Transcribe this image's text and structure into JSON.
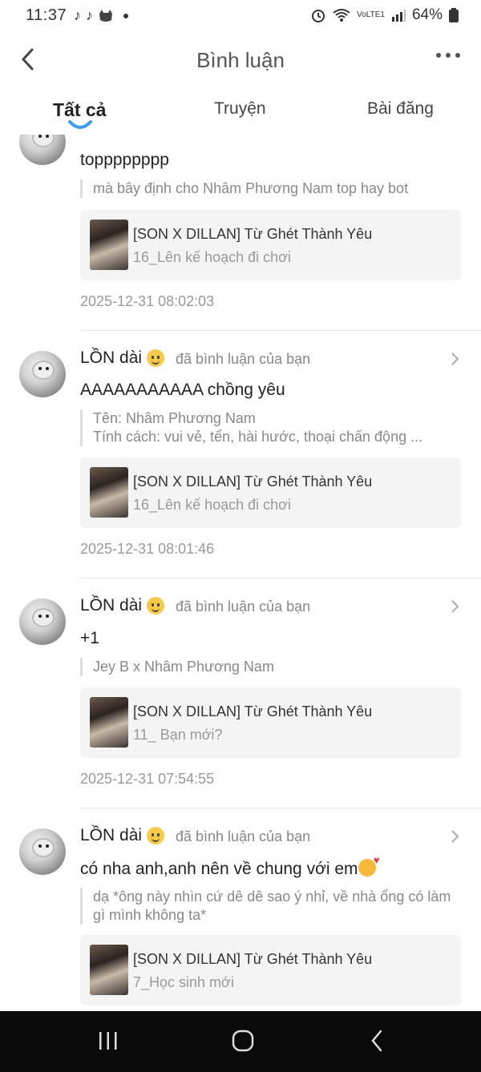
{
  "status_bar": {
    "time": "11:37",
    "battery": "64%",
    "network": "VoLTE1"
  },
  "header": {
    "title": "Bình luận"
  },
  "tabs": [
    {
      "label": "Tất cả",
      "active": true
    },
    {
      "label": "Truyện",
      "active": false
    },
    {
      "label": "Bài đăng",
      "active": false
    }
  ],
  "items": [
    {
      "comment": "topppppppp",
      "quote": "mà bây định cho Nhâm Phương Nam top hay bot",
      "card_title": "[SON X DILLAN] Từ Ghét Thành Yêu",
      "card_sub": "16_Lên kế hoạch đi chơi",
      "timestamp": "2025-12-31 08:02:03"
    },
    {
      "user": "LỒN dài",
      "action": "đã bình luận của bạn",
      "comment": "AAAAAAAAAAA chồng yêu",
      "quote_line1": "Tên: Nhâm Phương Nam",
      "quote_line2": "Tính cách: vui vẻ, tển, hài hước, thoại chấn động ...",
      "card_title": "[SON X DILLAN] Từ Ghét Thành Yêu",
      "card_sub": "16_Lên kế hoạch đi chơi",
      "timestamp": "2025-12-31 08:01:46"
    },
    {
      "user": "LỒN dài",
      "action": "đã bình luận của bạn",
      "comment": "+1",
      "quote": "Jey B x Nhâm Phương Nam",
      "card_title": "[SON X DILLAN] Từ Ghét Thành Yêu",
      "card_sub": "11_ Bạn mới?",
      "timestamp": "2025-12-31 07:54:55"
    },
    {
      "user": "LỒN dài",
      "action": "đã bình luận của bạn",
      "comment": "có nha anh,anh nên về chung với em",
      "quote_line1": "dạ *ông này nhìn cứ dê dê sao ý nhỉ, về nhà ổng có làm",
      "quote_line2": "gì mình không ta*",
      "card_title": "[SON X DILLAN] Từ Ghét Thành Yêu",
      "card_sub": "7_Học sinh mới"
    }
  ]
}
